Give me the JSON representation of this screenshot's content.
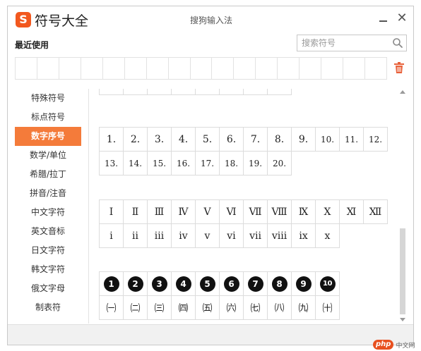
{
  "app": {
    "logo_letter": "S",
    "title": "符号大全",
    "window_title": "搜狗输入法",
    "close_symbol": "✕"
  },
  "recent": {
    "label": "最近使用",
    "cell_count": 17
  },
  "search": {
    "placeholder": "搜索符号",
    "value": ""
  },
  "categories": [
    {
      "label": "特殊符号",
      "active": false
    },
    {
      "label": "标点符号",
      "active": false
    },
    {
      "label": "数字序号",
      "active": true
    },
    {
      "label": "数学/单位",
      "active": false
    },
    {
      "label": "希腊/拉丁",
      "active": false
    },
    {
      "label": "拼音/注音",
      "active": false
    },
    {
      "label": "中文字符",
      "active": false
    },
    {
      "label": "英文音标",
      "active": false
    },
    {
      "label": "日文字符",
      "active": false
    },
    {
      "label": "韩文字符",
      "active": false
    },
    {
      "label": "俄文字母",
      "active": false
    },
    {
      "label": "制表符",
      "active": false
    }
  ],
  "symbol_groups": {
    "top_partial": [
      [
        "",
        "",
        "",
        "",
        "",
        "",
        "",
        ""
      ]
    ],
    "decimal": [
      [
        "1.",
        "2.",
        "3.",
        "4.",
        "5.",
        "6.",
        "7.",
        "8.",
        "9.",
        "10.",
        "11.",
        "12."
      ],
      [
        "13.",
        "14.",
        "15.",
        "16.",
        "17.",
        "18.",
        "19.",
        "20."
      ]
    ],
    "roman": [
      [
        "Ⅰ",
        "Ⅱ",
        "Ⅲ",
        "Ⅳ",
        "Ⅴ",
        "Ⅵ",
        "Ⅶ",
        "Ⅷ",
        "Ⅸ",
        "Ⅹ",
        "Ⅺ",
        "Ⅻ"
      ],
      [
        "ⅰ",
        "ⅱ",
        "ⅲ",
        "ⅳ",
        "ⅴ",
        "ⅵ",
        "ⅶ",
        "ⅷ",
        "ⅸ",
        "ⅹ"
      ]
    ],
    "circled": [
      [
        "1",
        "2",
        "3",
        "4",
        "5",
        "6",
        "7",
        "8",
        "9",
        "10"
      ],
      [
        "㈠",
        "㈡",
        "㈢",
        "㈣",
        "㈤",
        "㈥",
        "㈦",
        "㈧",
        "㈨",
        "㈩"
      ]
    ]
  },
  "scroll": {
    "position": 0.72
  },
  "watermark": {
    "logo": "php",
    "text": "中文网"
  },
  "colors": {
    "accent": "#f47b3a",
    "logo": "#f2581e"
  },
  "icons": {
    "search": "search-icon",
    "trash": "trash-icon",
    "minimize": "minimize-icon",
    "close": "close-icon"
  }
}
